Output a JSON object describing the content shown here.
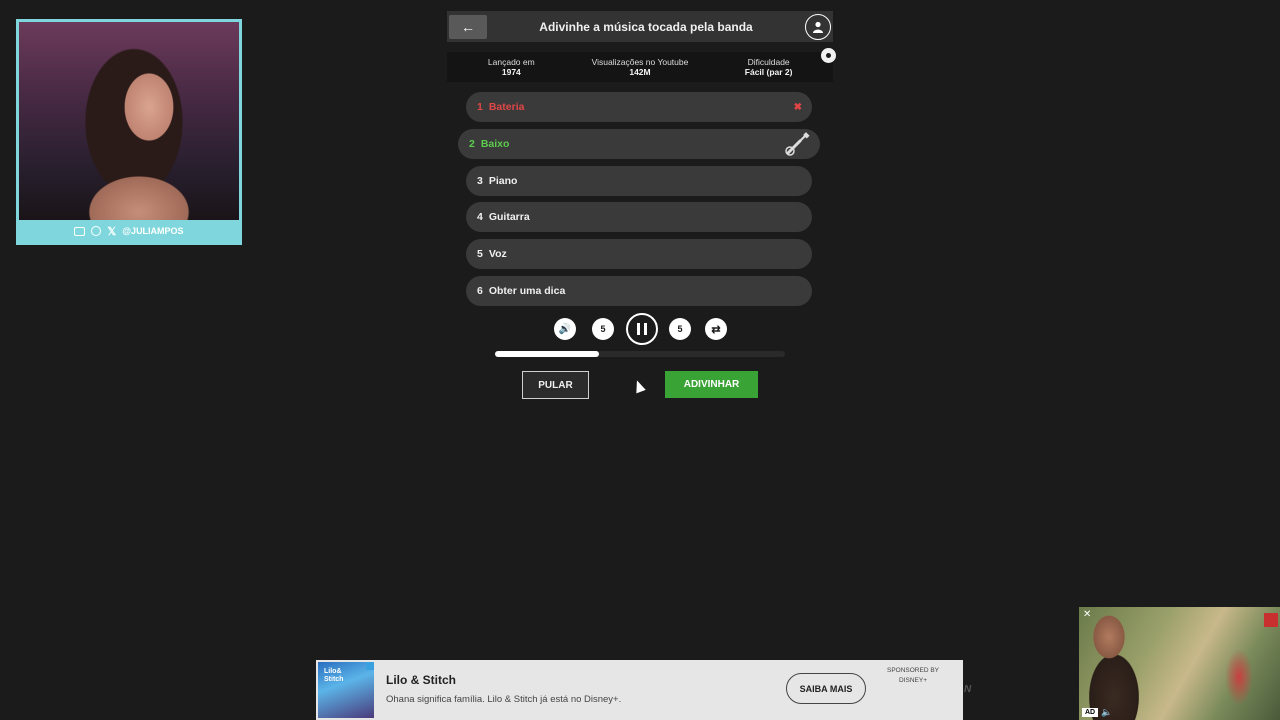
{
  "webcam": {
    "handle": "@JULIAMPOS",
    "icons": [
      "youtube-icon",
      "instagram-icon",
      "x-icon"
    ],
    "x_glyph": "𝕏"
  },
  "header": {
    "title": "Adivinhe a música tocada pela banda",
    "back_icon": "arrow-left-icon",
    "user_icon": "user-icon",
    "back_glyph": "←"
  },
  "info": {
    "released_label": "Lançado em",
    "released_value": "1974",
    "views_label": "Visualizações no Youtube",
    "views_value": "142M",
    "difficulty_label": "Dificuldade",
    "difficulty_value": "Fácil (par 2)"
  },
  "options": [
    {
      "num": "1",
      "label": "Bateria",
      "state": "wrong"
    },
    {
      "num": "2",
      "label": "Baixo",
      "state": "current"
    },
    {
      "num": "3",
      "label": "Piano",
      "state": "locked"
    },
    {
      "num": "4",
      "label": "Guitarra",
      "state": "locked"
    },
    {
      "num": "5",
      "label": "Voz",
      "state": "locked"
    },
    {
      "num": "6",
      "label": "Obter uma dica",
      "state": "locked"
    }
  ],
  "marks": {
    "wrong_glyph": "✖"
  },
  "controls": {
    "volume_glyph": "🔊",
    "rewind_label": "5",
    "forward_label": "5",
    "shuffle_glyph": "⇄",
    "progress": 0.36
  },
  "buttons": {
    "skip": "PULAR",
    "guess": "ADIVINHAR"
  },
  "ad_banner": {
    "title": "Lilo & Stitch",
    "description": "Ohana significa família. Lilo & Stitch já está no Disney+.",
    "cta": "SAIBA MAIS",
    "sponsor_line1": "SPONSORED BY",
    "sponsor_line2": "DISNEY+",
    "thumb_title_line1": "Lilo&",
    "thumb_title_line2": "Stitch",
    "side_glyph": "N"
  },
  "video_ad": {
    "badge": "AD",
    "close_glyph": "✕",
    "mute_glyph": "🔈"
  },
  "colors": {
    "background": "#1b1b1b",
    "wrong": "#e04646",
    "current": "#5dcc4e",
    "guess_button": "#3aa335",
    "webcam_frame": "#7fd7dd"
  }
}
